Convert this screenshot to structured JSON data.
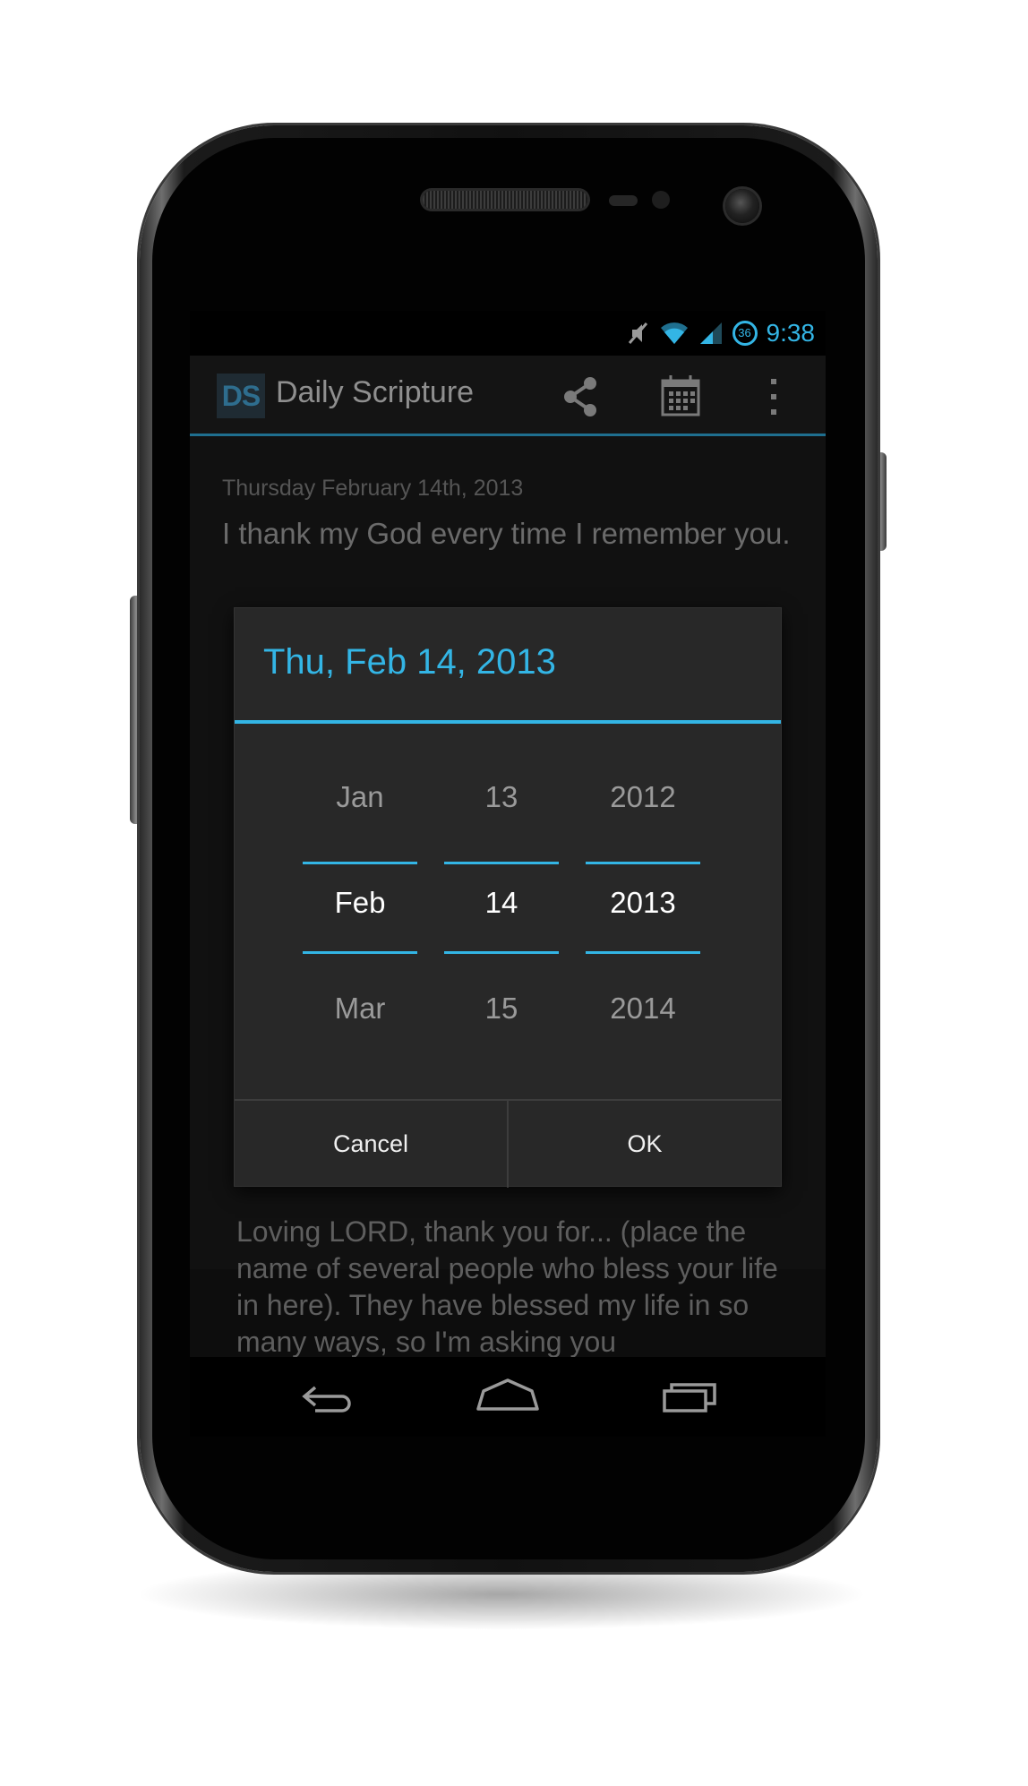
{
  "status_bar": {
    "time": "9:38",
    "battery_level": "36",
    "icons": [
      "mute-icon",
      "wifi-icon",
      "signal-icon",
      "battery-icon"
    ]
  },
  "action_bar": {
    "logo_text": "DS",
    "title": "Daily Scripture",
    "actions": [
      "share-icon",
      "calendar-icon",
      "overflow-menu-icon"
    ]
  },
  "content": {
    "date": "Thursday February 14th, 2013",
    "verse": "I thank my God every time I remember you.",
    "prayer_text": "Loving LORD, thank you for... (place the name of several people who bless your life in here). They have blessed my life in so many ways, so I'm asking you"
  },
  "date_picker": {
    "title": "Thu, Feb 14, 2013",
    "month": {
      "prev": "Jan",
      "current": "Feb",
      "next": "Mar"
    },
    "day": {
      "prev": "13",
      "current": "14",
      "next": "15"
    },
    "year": {
      "prev": "2012",
      "current": "2013",
      "next": "2014"
    },
    "cancel_label": "Cancel",
    "ok_label": "OK"
  },
  "navigation": [
    "back-icon",
    "home-icon",
    "recent-apps-icon"
  ],
  "colors": {
    "accent": "#33b5e5",
    "dialog_bg": "#282828",
    "screen_bg": "#111111"
  }
}
